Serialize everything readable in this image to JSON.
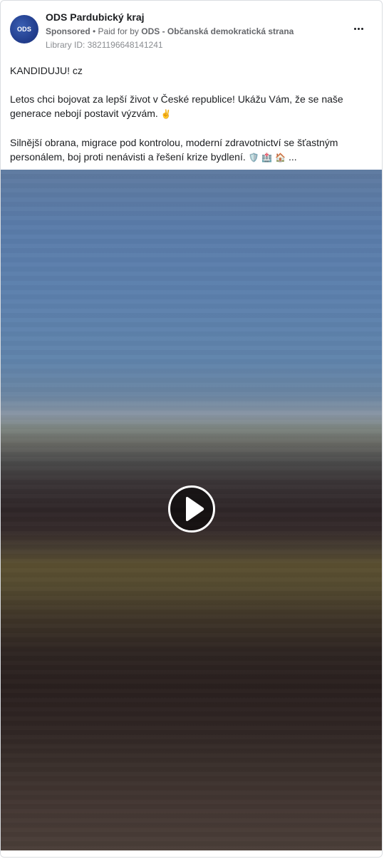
{
  "ad": {
    "page_name": "ODS Pardubický kraj",
    "avatar_text": "ODS",
    "sponsored_label": "Sponsored",
    "separator": " • ",
    "paid_for_prefix": "Paid for by ",
    "paid_for_by": "ODS - Občanská demokratická strana",
    "library_id": "Library ID: 3821196648141241",
    "more_options_icon": "ellipsis-icon"
  },
  "post": {
    "line1": "KANDIDUJU! cz",
    "paragraph2": "Letos chci bojovat za lepší život v České republice! Ukážu Vám, že se naše generace nebojí postavit výzvám.",
    "paragraph2_emoji": "✌️",
    "paragraph3": "Silnější obrana, migrace pod kontrolou, moderní zdravotnictví se šťastným personálem, boj proti nenávisti a řešení krize bydlení.",
    "paragraph3_emojis": "🛡️ 🏥 🏠",
    "ellipsis": "..."
  },
  "video": {
    "play_icon": "play-icon",
    "colors": {
      "sky": "#5c80ad",
      "ground": "#2f2628",
      "play_ring": "#ffffff"
    }
  }
}
